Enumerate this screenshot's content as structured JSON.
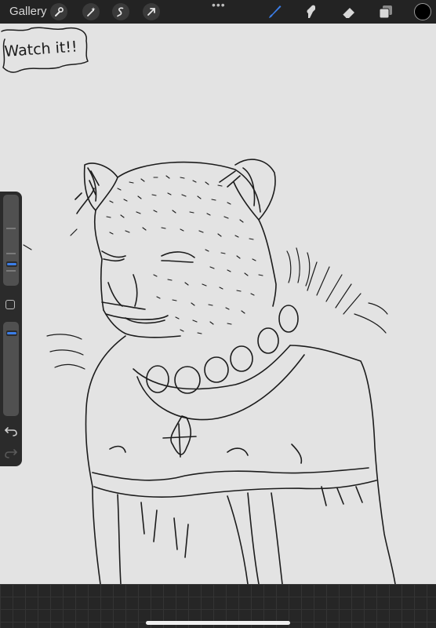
{
  "topbar": {
    "gallery_label": "Gallery",
    "more_dots": "•••",
    "left_tools": [
      "wrench-icon",
      "magic-wand-icon",
      "selection-icon",
      "transform-arrow-icon"
    ],
    "right_tools": [
      "brush-icon",
      "smudge-icon",
      "eraser-icon",
      "layers-icon"
    ],
    "active_tool": "brush-icon",
    "accent_color": "#3b7ee8",
    "current_color": "#000000"
  },
  "canvas": {
    "speech_bubble_text": "Watch it!!",
    "background_color": "#e3e3e3"
  },
  "sidebar": {
    "brush_size_icon": "size-slider",
    "opacity_icon": "opacity-slider",
    "modify_icon": "square-icon",
    "undo_icon": "undo-icon",
    "redo_icon": "redo-icon"
  }
}
